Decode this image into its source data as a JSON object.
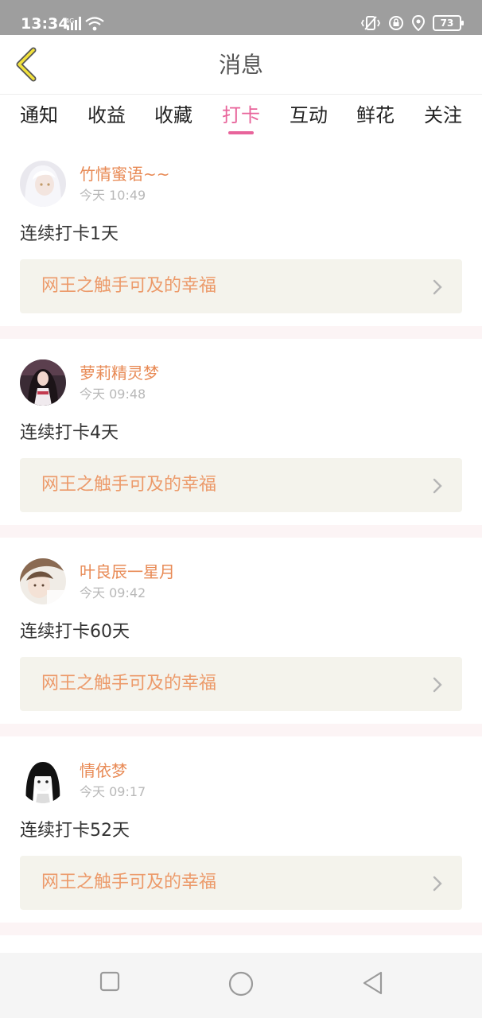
{
  "status_bar": {
    "time": "13:34",
    "battery": "73",
    "icons": [
      "4g-signal-icon",
      "wifi-icon",
      "vibrate-icon",
      "lock-icon",
      "location-icon",
      "battery-icon"
    ]
  },
  "header": {
    "title": "消息",
    "back_icon": "back-chevron-icon"
  },
  "tabs": [
    {
      "label": "通知"
    },
    {
      "label": "收益"
    },
    {
      "label": "收藏"
    },
    {
      "label": "打卡",
      "active": true
    },
    {
      "label": "互动"
    },
    {
      "label": "鲜花"
    },
    {
      "label": "关注"
    }
  ],
  "messages": [
    {
      "username": "竹情蜜语~~",
      "time": "今天 10:49",
      "text": "连续打卡1天",
      "book": "网王之触手可及的幸福"
    },
    {
      "username": "萝莉精灵梦",
      "time": "今天 09:48",
      "text": "连续打卡4天",
      "book": "网王之触手可及的幸福"
    },
    {
      "username": "叶良辰一星月",
      "time": "今天 09:42",
      "text": "连续打卡60天",
      "book": "网王之触手可及的幸福"
    },
    {
      "username": "情依梦",
      "time": "今天 09:17",
      "text": "连续打卡52天",
      "book": "网王之触手可及的幸福"
    }
  ],
  "colors": {
    "accent": "#e8649b",
    "username": "#e88a55",
    "book_title": "#ec9a6a",
    "book_bg": "#f4f3ec",
    "statusbar": "#9e9e9e"
  },
  "nav_bar": {
    "icons": [
      "recent-apps-icon",
      "home-icon",
      "back-icon"
    ]
  }
}
